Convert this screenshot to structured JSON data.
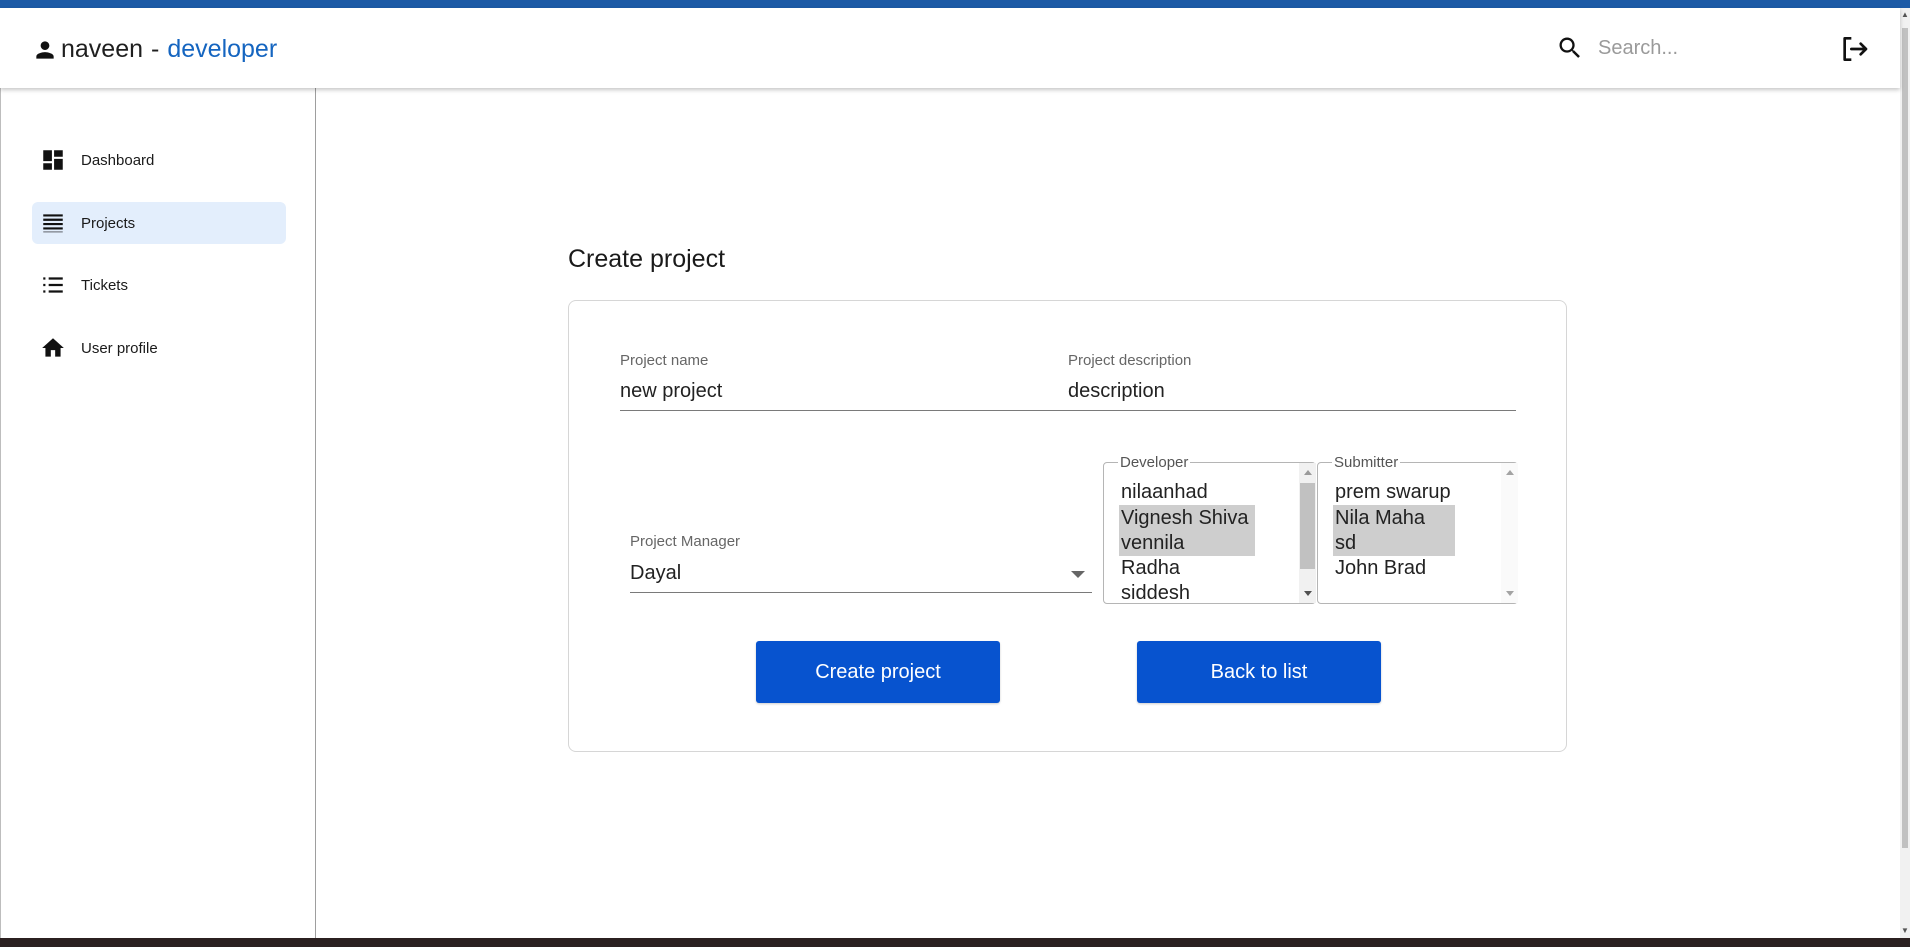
{
  "header": {
    "user_name": "naveen",
    "separator": "-",
    "user_role": "developer",
    "search_placeholder": "Search..."
  },
  "sidebar": {
    "items": [
      {
        "label": "Dashboard",
        "icon": "dashboard-icon"
      },
      {
        "label": "Projects",
        "icon": "list-icon",
        "active": true
      },
      {
        "label": "Tickets",
        "icon": "bulleted-list-icon"
      },
      {
        "label": "User profile",
        "icon": "home-icon"
      }
    ]
  },
  "form": {
    "title": "Create project",
    "project_name_label": "Project name",
    "project_name_value": "new project",
    "project_description_label": "Project description",
    "project_description_value": "description",
    "project_manager_label": "Project Manager",
    "project_manager_value": "Dayal",
    "developer": {
      "legend": "Developer",
      "options": [
        {
          "label": "nilaanhad",
          "selected": false
        },
        {
          "label": "Vignesh Shiva",
          "selected": true
        },
        {
          "label": "vennila",
          "selected": true
        },
        {
          "label": "Radha",
          "selected": false
        },
        {
          "label": "siddesh",
          "selected": false
        }
      ]
    },
    "submitter": {
      "legend": "Submitter",
      "options": [
        {
          "label": "prem swarup",
          "selected": false
        },
        {
          "label": "Nila Maha",
          "selected": true
        },
        {
          "label": "sd",
          "selected": true
        },
        {
          "label": "John Brad",
          "selected": false
        }
      ]
    },
    "create_button": "Create project",
    "back_button": "Back to list"
  },
  "colors": {
    "accent": "#1565c0",
    "button": "#0753cf",
    "active_nav": "#e3eefc",
    "top_stripe": "#1c5aa6"
  }
}
